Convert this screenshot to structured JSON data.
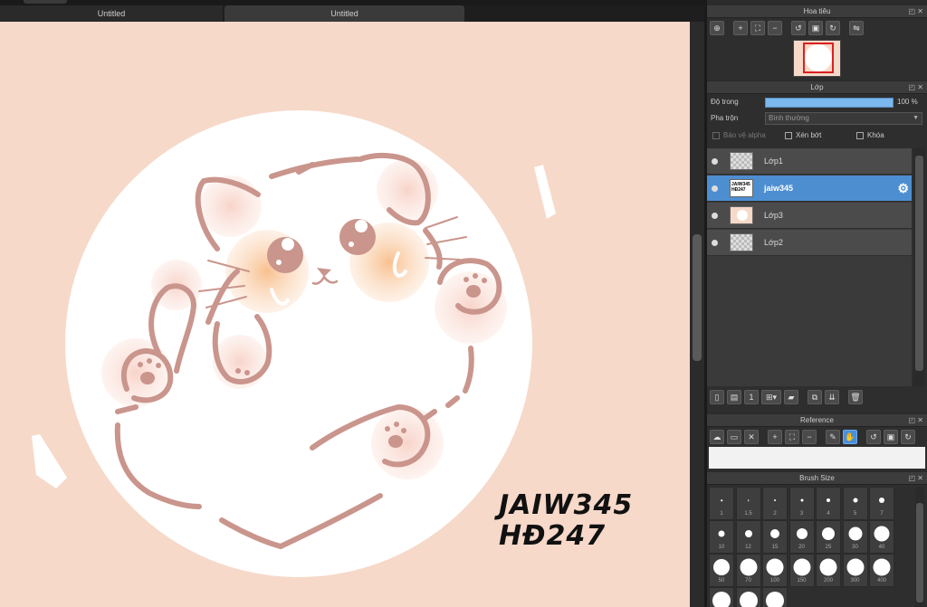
{
  "tabs": [
    {
      "label": "Untitled"
    },
    {
      "label": "Untitled"
    }
  ],
  "signature": {
    "line1": "JAIW345",
    "line2": "HĐ247"
  },
  "navigator": {
    "title": "Hoa tiêu"
  },
  "layers_panel": {
    "title": "Lớp",
    "opacity_label": "Độ trong",
    "opacity_value": "100 %",
    "opacity_fraction": 1.0,
    "blend_label": "Pha trộn",
    "blend_value": "Bình thường",
    "protect_alpha": "Bảo vệ alpha",
    "clipping": "Xén bớt",
    "lock": "Khóa",
    "layers": [
      {
        "name": "Lớp1"
      },
      {
        "name": "jaiw345",
        "thumb_text": "JAIW345 HĐ247",
        "selected": true
      },
      {
        "name": "Lớp3"
      },
      {
        "name": "Lớp2"
      }
    ]
  },
  "reference": {
    "title": "Reference"
  },
  "brush_size": {
    "title": "Brush Size",
    "sizes": [
      "1",
      "1.5",
      "2",
      "3",
      "4",
      "5",
      "7",
      "10",
      "12",
      "15",
      "20",
      "25",
      "30",
      "40",
      "50",
      "70",
      "100",
      "150",
      "200",
      "300",
      "400"
    ]
  },
  "colors": {
    "canvas_bg": "#f6d9c9",
    "line_color": "#c9958c",
    "accent": "#4d8ed1"
  }
}
